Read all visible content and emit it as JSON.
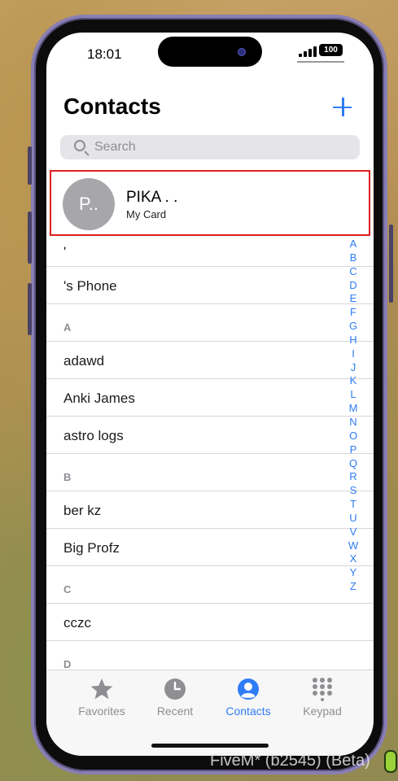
{
  "status_bar": {
    "time": "18:01",
    "battery": "100"
  },
  "header": {
    "title": "Contacts"
  },
  "search": {
    "placeholder": "Search"
  },
  "my_card": {
    "initials": "P..",
    "name": "PIKA . .",
    "subtitle": "My Card"
  },
  "list": {
    "rows": [
      {
        "type": "row-small",
        "text": "'"
      },
      {
        "type": "row",
        "text": "'s Phone"
      },
      {
        "type": "header",
        "text": "A"
      },
      {
        "type": "row",
        "text": "adawd"
      },
      {
        "type": "row",
        "text": "Anki James"
      },
      {
        "type": "row",
        "text": "astro logs"
      },
      {
        "type": "header",
        "text": "B"
      },
      {
        "type": "row",
        "text": "ber kz"
      },
      {
        "type": "row",
        "text": "Big Profz"
      },
      {
        "type": "header",
        "text": "C"
      },
      {
        "type": "row",
        "text": "cczc"
      },
      {
        "type": "header",
        "text": "D"
      }
    ]
  },
  "index": [
    "A",
    "B",
    "C",
    "D",
    "E",
    "F",
    "G",
    "H",
    "I",
    "J",
    "K",
    "L",
    "M",
    "N",
    "O",
    "P",
    "Q",
    "R",
    "S",
    "T",
    "U",
    "V",
    "W",
    "X",
    "Y",
    "Z"
  ],
  "tabs": [
    {
      "label": "Favorites",
      "icon": "star-icon",
      "active": false
    },
    {
      "label": "Recent",
      "icon": "clock-icon",
      "active": false
    },
    {
      "label": "Contacts",
      "icon": "person-circle-icon",
      "active": true
    },
    {
      "label": "Keypad",
      "icon": "keypad-icon",
      "active": false
    }
  ],
  "overlay": {
    "text": "FiveM* (b2545) (Beta)"
  },
  "colors": {
    "accent": "#2f7cf6",
    "highlight_border": "#e02020",
    "frame": "#8a7fb3"
  }
}
